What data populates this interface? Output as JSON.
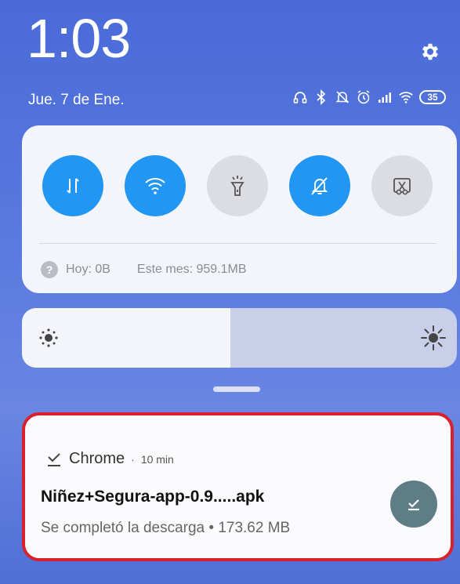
{
  "status_bar": {
    "time": "1:03",
    "date": "Jue. 7 de Ene.",
    "battery_level": "35",
    "icons": [
      "headset-icon",
      "bluetooth-icon",
      "do-not-disturb-icon",
      "alarm-icon",
      "cellular-signal-icon",
      "wifi-icon",
      "battery-icon"
    ]
  },
  "quick_settings": {
    "toggles": [
      {
        "name": "mobile-data",
        "icon": "data-transfer-icon",
        "state": "on"
      },
      {
        "name": "wifi",
        "icon": "wifi-icon",
        "state": "on"
      },
      {
        "name": "flashlight",
        "icon": "flashlight-icon",
        "state": "off"
      },
      {
        "name": "silent-mode",
        "icon": "bell-off-icon",
        "state": "on"
      },
      {
        "name": "screenshot",
        "icon": "screenshot-scissors-icon",
        "state": "off"
      }
    ],
    "data_usage": {
      "today": "Hoy: 0B",
      "month": "Este mes: 959.1MB"
    }
  },
  "brightness": {
    "level": 0.48
  },
  "notification": {
    "app": "Chrome",
    "separator": "·",
    "time": "10 min",
    "title": "Niñez+Segura-app-0.9.....apk",
    "text": "Se completó la descarga • 173.62 MB",
    "highlight_color": "#d9202c"
  },
  "colors": {
    "accent": "#2196f3",
    "toggle_off": "#dcdde2",
    "action_button": "#5e7d87"
  }
}
